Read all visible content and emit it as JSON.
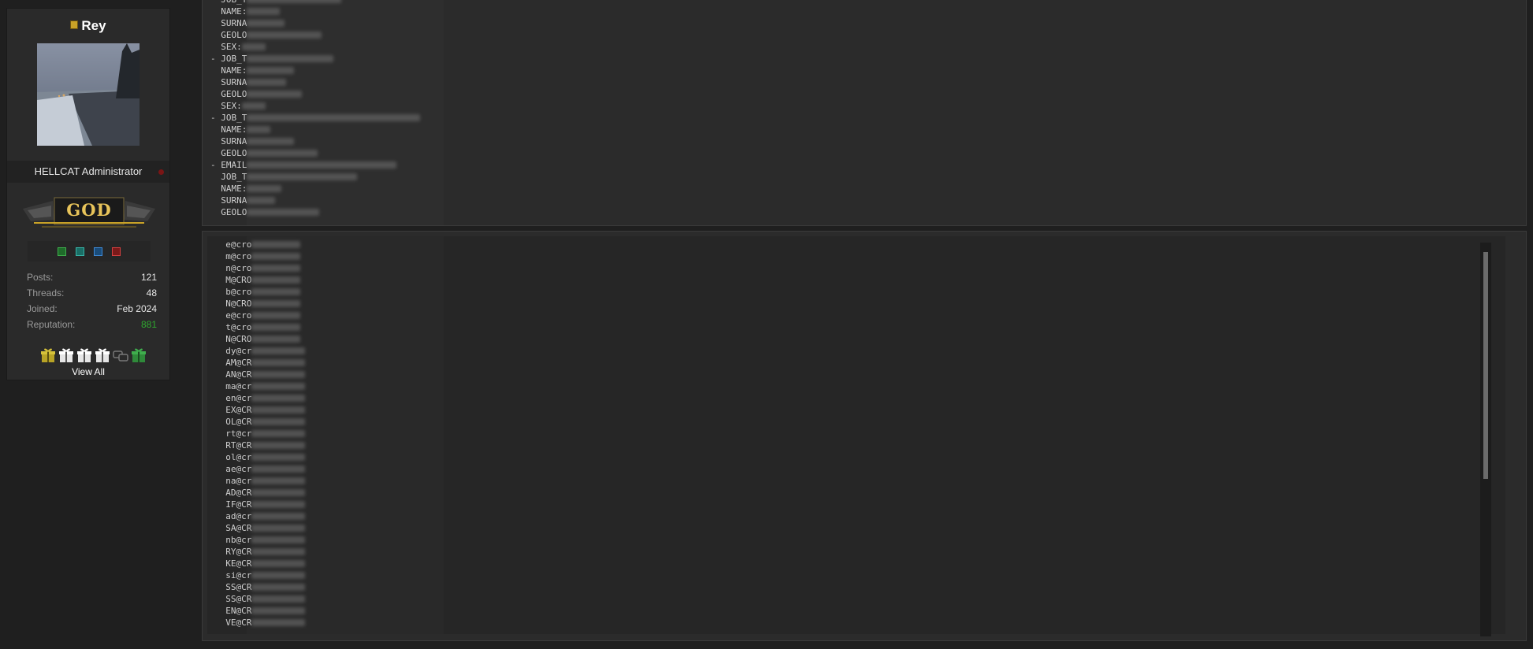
{
  "profile": {
    "username": "Rey",
    "user_title": "HELLCAT Administrator",
    "rank_label": "GOD",
    "stats": [
      {
        "label": "Posts:",
        "value": "121"
      },
      {
        "label": "Threads:",
        "value": "48"
      },
      {
        "label": "Joined:",
        "value": "Feb 2024"
      },
      {
        "label": "Reputation:",
        "value": "881"
      }
    ],
    "view_all_label": "View All",
    "colors": {
      "reputation": "#2fa82f",
      "online_dot": "#7a1515",
      "rank_gold": "#e8c45a"
    }
  },
  "code_block_1": {
    "lines": [
      {
        "prefix": "  JOB_T"
      },
      {
        "prefix": "  NAME:"
      },
      {
        "prefix": "  SURNA"
      },
      {
        "prefix": "  GEOLO"
      },
      {
        "prefix": "  SEX:"
      },
      {
        "prefix": "- JOB_T"
      },
      {
        "prefix": "  NAME:"
      },
      {
        "prefix": "  SURNA"
      },
      {
        "prefix": "  GEOLO"
      },
      {
        "prefix": "  SEX:"
      },
      {
        "prefix": "- JOB_T"
      },
      {
        "prefix": "  NAME:"
      },
      {
        "prefix": "  SURNA"
      },
      {
        "prefix": "  GEOLO"
      },
      {
        "prefix": "- EMAIL"
      },
      {
        "prefix": "  JOB_T"
      },
      {
        "prefix": "  NAME:"
      },
      {
        "prefix": "  SURNA"
      },
      {
        "prefix": "  GEOLO"
      }
    ]
  },
  "code_block_2": {
    "lines": [
      {
        "prefix": "  e@cro"
      },
      {
        "prefix": "  m@cro"
      },
      {
        "prefix": "  n@cro"
      },
      {
        "prefix": "  M@CRO"
      },
      {
        "prefix": "  b@cro"
      },
      {
        "prefix": "  N@CRO"
      },
      {
        "prefix": "  e@cro"
      },
      {
        "prefix": "  t@cro"
      },
      {
        "prefix": "  N@CRO"
      },
      {
        "prefix": "  dy@cr"
      },
      {
        "prefix": "  AM@CR"
      },
      {
        "prefix": "  AN@CR"
      },
      {
        "prefix": "  ma@cr"
      },
      {
        "prefix": "  en@cr"
      },
      {
        "prefix": "  EX@CR"
      },
      {
        "prefix": "  OL@CR"
      },
      {
        "prefix": "  rt@cr"
      },
      {
        "prefix": "  RT@CR"
      },
      {
        "prefix": "  ol@cr"
      },
      {
        "prefix": "  ae@cr"
      },
      {
        "prefix": "  na@cr"
      },
      {
        "prefix": "  AD@CR"
      },
      {
        "prefix": "  IF@CR"
      },
      {
        "prefix": "  ad@cr"
      },
      {
        "prefix": "  SA@CR"
      },
      {
        "prefix": "  nb@cr"
      },
      {
        "prefix": "  RY@CR"
      },
      {
        "prefix": "  KE@CR"
      },
      {
        "prefix": "  si@cr"
      },
      {
        "prefix": "  SS@CR"
      },
      {
        "prefix": "  SS@CR"
      },
      {
        "prefix": "  EN@CR"
      },
      {
        "prefix": "  VE@CR"
      }
    ]
  }
}
